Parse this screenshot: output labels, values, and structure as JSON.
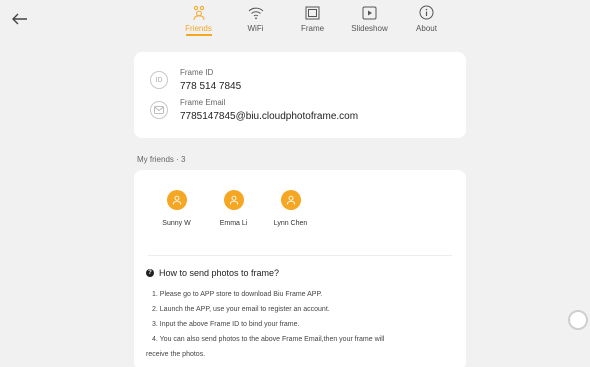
{
  "nav": {
    "items": [
      {
        "label": "Friends",
        "icon": "friends-icon",
        "active": true
      },
      {
        "label": "WiFi",
        "icon": "wifi-icon"
      },
      {
        "label": "Frame",
        "icon": "frame-icon"
      },
      {
        "label": "Slideshow",
        "icon": "slideshow-icon"
      },
      {
        "label": "About",
        "icon": "info-icon"
      }
    ]
  },
  "frame_info": {
    "id_label": "Frame ID",
    "id_value": "778 514 7845",
    "id_icon_text": "ID",
    "email_label": "Frame Email",
    "email_value": "7785147845@biu.cloudphotoframe.com"
  },
  "friends": {
    "title": "My friends · 3",
    "list": [
      {
        "name": "Sunny W"
      },
      {
        "name": "Emma Li"
      },
      {
        "name": "Lynn Chen"
      }
    ]
  },
  "howto": {
    "title": "How to send photos to frame?",
    "steps": [
      "1. Please go to APP store to download Biu Frame APP.",
      "2. Launch the APP, use your email to register an account.",
      "3. Input the above Frame ID to bind your frame.",
      "4. You can also send photos to the above Frame Email,then your frame will"
    ],
    "step4_cont": "receive the photos."
  },
  "colors": {
    "accent": "#f5a623",
    "background": "#f1f1f1"
  }
}
